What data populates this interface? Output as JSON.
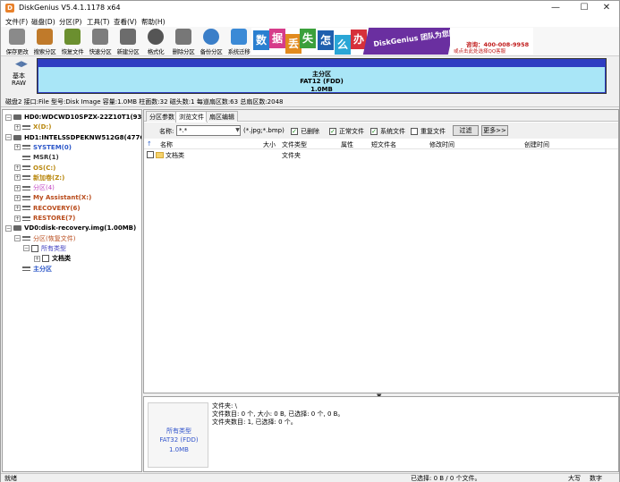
{
  "window": {
    "title": "DiskGenius V5.4.1.1178 x64",
    "app_icon": "D",
    "controls": {
      "minimize": "—",
      "maximize": "☐",
      "close": "✕"
    }
  },
  "menu": [
    "文件(F)",
    "磁盘(D)",
    "分区(P)",
    "工具(T)",
    "查看(V)",
    "帮助(H)"
  ],
  "toolbar": [
    {
      "label": "保存更改",
      "icon": "save-icon",
      "color": "#8a8a8a"
    },
    {
      "label": "搜索分区",
      "icon": "magnifier-icon",
      "color": "#c07a2a"
    },
    {
      "label": "恢复文件",
      "icon": "recover-icon",
      "color": "#6b8f2f"
    },
    {
      "label": "快速分区",
      "icon": "disk-icon",
      "color": "#7d7d7d"
    },
    {
      "label": "新建分区",
      "icon": "stack-icon",
      "color": "#6c6c6c"
    },
    {
      "label": "格式化",
      "icon": "gear-icon",
      "color": "#555555"
    },
    {
      "label": "删除分区",
      "icon": "trash-icon",
      "color": "#777777"
    },
    {
      "label": "备份分区",
      "icon": "pie-icon",
      "color": "#3a7ec8"
    },
    {
      "label": "系统迁移",
      "icon": "monitor-icon",
      "color": "#3b8ad6"
    }
  ],
  "banner": {
    "chars": [
      "数",
      "据",
      "丢",
      "失",
      "怎",
      "么",
      "办"
    ],
    "slogan": "DiskGenius 团队为您服务",
    "phone": "咨询：400-008-9958",
    "qq": "或点击此处选择QQ客服",
    "colors": [
      "#2a7fd0",
      "#d63c8a",
      "#e28b1e",
      "#3ba03b",
      "#1f5fae",
      "#2aa6d6",
      "#d6303a"
    ]
  },
  "diskbar": {
    "basic": "基本",
    "raw": "RAW",
    "partition_name": "主分区",
    "partition_fs": "FAT12 (FDD)",
    "partition_size": "1.0MB"
  },
  "infoline": "磁盘2 接口:File  型号:Disk Image  容量:1.0MB  柱面数:32  磁头数:1  每道扇区数:63  总扇区数:2048",
  "tree": [
    {
      "label": "HD0:WDCWD10SPZX-22Z10T1(932GB)",
      "color": "#000000",
      "bold": true,
      "level": 0,
      "exp": "−",
      "kind": "disk"
    },
    {
      "label": "X(D:)",
      "color": "#b8860b",
      "bold": true,
      "level": 1,
      "exp": "+",
      "kind": "part"
    },
    {
      "label": "HD1:INTELSSDPEKNW512G8(477GB)",
      "color": "#000000",
      "bold": true,
      "level": 0,
      "exp": "−",
      "kind": "disk"
    },
    {
      "label": "SYSTEM(0)",
      "color": "#2a55c8",
      "bold": true,
      "level": 1,
      "exp": "+",
      "kind": "part"
    },
    {
      "label": "MSR(1)",
      "color": "#333333",
      "bold": true,
      "level": 1,
      "exp": "",
      "kind": "part"
    },
    {
      "label": "OS(C:)",
      "color": "#b8860b",
      "bold": true,
      "level": 1,
      "exp": "+",
      "kind": "part"
    },
    {
      "label": "新加卷(Z:)",
      "color": "#b8860b",
      "bold": true,
      "level": 1,
      "exp": "+",
      "kind": "part"
    },
    {
      "label": "分区(4)",
      "color": "#c040c0",
      "bold": false,
      "level": 1,
      "exp": "+",
      "kind": "part"
    },
    {
      "label": "My Assistant(X:)",
      "color": "#b84a1a",
      "bold": true,
      "level": 1,
      "exp": "+",
      "kind": "part"
    },
    {
      "label": "RECOVERY(6)",
      "color": "#b84a1a",
      "bold": true,
      "level": 1,
      "exp": "+",
      "kind": "part"
    },
    {
      "label": "RESTORE(7)",
      "color": "#b84a1a",
      "bold": true,
      "level": 1,
      "exp": "+",
      "kind": "part"
    },
    {
      "label": "VD0:disk-recovery.img(1.00MB)",
      "color": "#000000",
      "bold": true,
      "level": 0,
      "exp": "−",
      "kind": "disk"
    },
    {
      "label": "分区(恢复文件)",
      "color": "#b84a1a",
      "bold": false,
      "level": 1,
      "exp": "−",
      "kind": "part"
    },
    {
      "label": "所有类型",
      "color": "#4040c0",
      "bold": false,
      "level": 2,
      "exp": "−",
      "kind": "check"
    },
    {
      "label": "文档类",
      "color": "#000000",
      "bold": true,
      "level": 3,
      "exp": "+",
      "kind": "check"
    },
    {
      "label": "主分区",
      "color": "#2a55c8",
      "bold": true,
      "level": 1,
      "exp": "",
      "kind": "part"
    }
  ],
  "tabs": [
    "分区参数",
    "浏览文件",
    "扇区编辑"
  ],
  "active_tab": 1,
  "filter": {
    "name_label": "名称:",
    "name_value": "*.*",
    "hint": "(*.jpg;*.bmp)",
    "deleted": "已删除",
    "normal": "正常文件",
    "system": "系统文件",
    "duplicate": "重复文件",
    "filter_button": "过滤",
    "more_button": "更多>>",
    "check_mark": "✓"
  },
  "columns": [
    "名称",
    "大小",
    "文件类型",
    "属性",
    "短文件名",
    "修改时间",
    "创建时间"
  ],
  "files": [
    {
      "name": "文档类",
      "type": "文件夹"
    }
  ],
  "splitter": "▼",
  "bottom": {
    "thumb_type": "所有类型",
    "thumb_fs": "FAT32 (FDD)",
    "thumb_size": "1.0MB",
    "line1": "文件夹: \\",
    "line2": "文件数目: 0 个, 大小: 0 B, 已选择: 0 个, 0 B。",
    "line3": "文件夹数目: 1, 已选择: 0 个。"
  },
  "status": {
    "left": "就绪",
    "selected": "已选择: 0 B / 0 个文件。",
    "caps": "大写",
    "num": "数字"
  }
}
